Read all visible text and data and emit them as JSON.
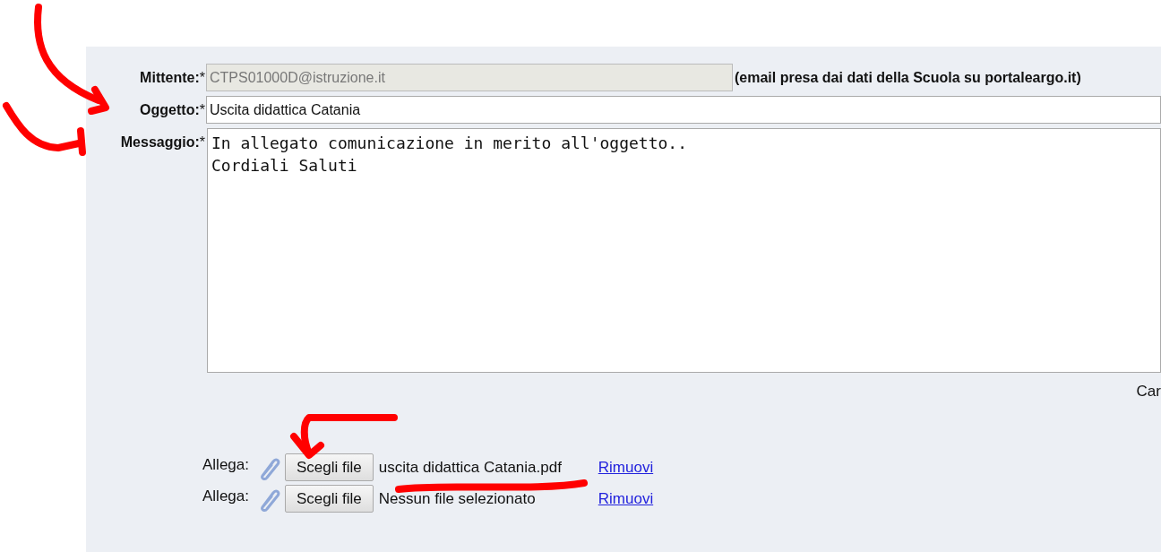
{
  "sender": {
    "label": "Mittente:",
    "required_mark": "*",
    "value": "CTPS01000D@istruzione.it",
    "disabled": true,
    "note": "(email presa dai dati della Scuola su portaleargo.it)"
  },
  "subject": {
    "label": "Oggetto:",
    "required_mark": "*",
    "value": "Uscita didattica Catania"
  },
  "message": {
    "label": "Messaggio:",
    "required_mark": "*",
    "value": "In allegato comunicazione in merito all'oggetto..\nCordiali Saluti"
  },
  "cut_text": "Car",
  "attachments": [
    {
      "label": "Allega:",
      "button": "Scegli file",
      "file_name": "uscita didattica Catania.pdf",
      "remove_link": "Rimuovi"
    },
    {
      "label": "Allega:",
      "button": "Scegli file",
      "file_name": "Nessun file selezionato",
      "remove_link": "Rimuovi"
    }
  ]
}
